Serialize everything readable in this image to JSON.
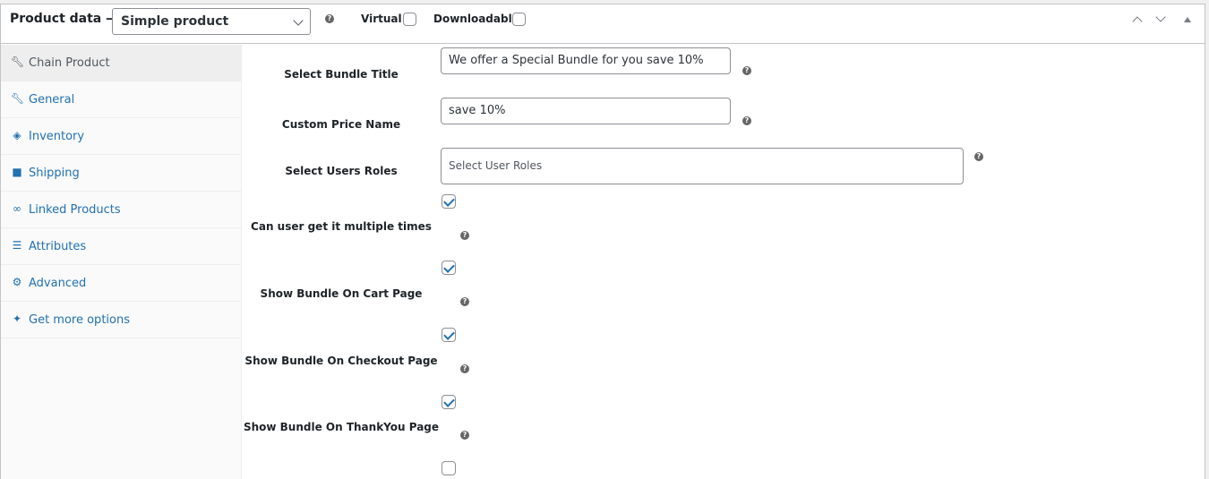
{
  "header": {
    "title": "Product data —",
    "product_type": "Simple product",
    "virtual_label": "Virtual:",
    "virtual_checked": false,
    "downloadable_label": "Downloadable:",
    "downloadable_checked": false
  },
  "sidebar": {
    "items": [
      {
        "label": "Chain Product",
        "icon": "wrench-icon",
        "active": true
      },
      {
        "label": "General",
        "icon": "wrench-icon",
        "active": false
      },
      {
        "label": "Inventory",
        "icon": "tag-icon",
        "active": false
      },
      {
        "label": "Shipping",
        "icon": "truck-icon",
        "active": false
      },
      {
        "label": "Linked Products",
        "icon": "link-icon",
        "active": false
      },
      {
        "label": "Attributes",
        "icon": "list-icon",
        "active": false
      },
      {
        "label": "Advanced",
        "icon": "gear-icon",
        "active": false
      },
      {
        "label": "Get more options",
        "icon": "plugin-icon",
        "active": false
      }
    ]
  },
  "form": {
    "bundle_title_label": "Select Bundle Title",
    "bundle_title_value": "We offer a Special Bundle for you save 10%",
    "custom_price_label": "Custom Price Name",
    "custom_price_value": "save 10%",
    "user_roles_label": "Select Users Roles",
    "user_roles_placeholder": "Select User Roles",
    "multiple_times_label": "Can user get it multiple times",
    "multiple_times_checked": true,
    "cart_page_label": "Show Bundle On Cart Page",
    "cart_page_checked": true,
    "checkout_page_label": "Show Bundle On Checkout Page",
    "checkout_page_checked": true,
    "thankyou_page_label": "Show Bundle On ThankYou Page",
    "thankyou_page_checked": true,
    "extra_checked": false
  },
  "colors": {
    "link": "#2271b1",
    "border": "#8c8f94",
    "active_tab_bg": "#eeeeee"
  }
}
